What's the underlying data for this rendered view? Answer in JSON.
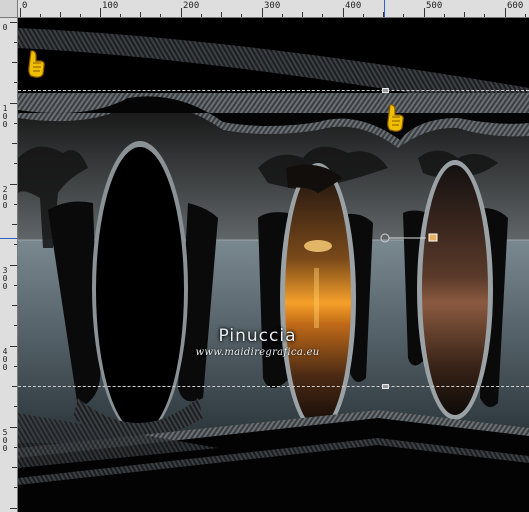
{
  "ruler": {
    "top_labels": [
      "0",
      "100",
      "200",
      "300",
      "400",
      "500",
      "600"
    ],
    "left_labels": [
      "0",
      "100",
      "200",
      "300",
      "400",
      "500"
    ]
  },
  "watermark": {
    "name": "Pinuccia",
    "url": "www.maidiregrafica.eu"
  },
  "colors": {
    "ruler_bg": "#dedede",
    "canvas_bg": "#000000",
    "sunset_glow": "#f6a02a",
    "water": "#5a6a70",
    "pointer_hand": "#f0c000"
  },
  "icons": [
    "pointer-hand-icon",
    "pointer-hand-icon",
    "guide-handle-icon"
  ]
}
